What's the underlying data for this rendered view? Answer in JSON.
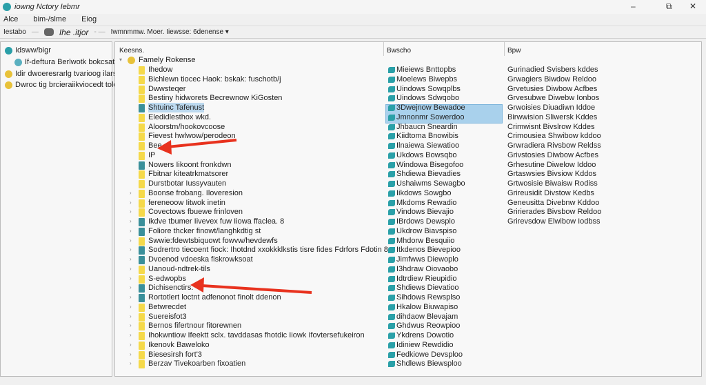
{
  "window": {
    "title": "iowng Nctory Iebmr",
    "minimize": "–",
    "maximize": "⧉",
    "close": "✕"
  },
  "menu": [
    "Alce",
    "bim-/slme",
    "Eiog"
  ],
  "toolbar": {
    "left": "Iestabo",
    "path": "Ihe .itjor",
    "crumb": "Iwmnmmw. Moer. Iiewsse: 6denense ▾"
  },
  "sidebar": [
    {
      "label": "Idsww/bigr",
      "icon": "globe-icon"
    },
    {
      "label": "If-deftura Berlwotk bokcsats",
      "icon": "network-icon"
    },
    {
      "label": "Idir dwoeresrarlg tvarioog ilarse",
      "icon": "gear-icon"
    },
    {
      "label": "Dwroc tig brcieraiikviocedt tolesir",
      "icon": "key-icon"
    }
  ],
  "columns": {
    "name": "Keesns.",
    "data": "Bwscho",
    "type": "Bpw"
  },
  "root": "Famely Rokense",
  "rows": [
    {
      "n": "Ihedow",
      "d": "Mieiews Bnttopbs",
      "t": "Gurinadied Svisbers kddes"
    },
    {
      "n": "Bichlewn tiocec Haok: bskak: fuschotb/j",
      "d": "Moelews Biwepbs",
      "t": "Grwagiers Biwdow Reldoo"
    },
    {
      "n": "Dwwsteqer",
      "d": "Uindows Sowqplbs",
      "t": "Grvetusies Diwbow Acfbes"
    },
    {
      "n": "Bestiny hidworets Becrewnow KiGosten",
      "d": "Uindows Sdwqobo",
      "t": "Grvesubwe Diwebw Ionbos"
    },
    {
      "n": "Shtuinc Tafenust",
      "d": "3Dwejnow Bewadoe",
      "t": "Grwoisies Diuadiwn Iddoe",
      "sel": true
    },
    {
      "n": "Eledidlesthox wkd.",
      "d": "Jmnonmr Sowerdoo",
      "t": "Birwwision Sliwersk Kddes",
      "sel2": true
    },
    {
      "n": "Aloorstm/hookovcoose",
      "d": "Jhbaucn Sneardin",
      "t": "Crimwisnt Bivslrow Kddes"
    },
    {
      "n": "Fievest hwlwow/perodeon",
      "d": "Kiidtoma Bnowibis",
      "t": "Crimousiea Shwibow kddoo"
    },
    {
      "n": "Bee",
      "d": "Ilnaiewa Siewatioo",
      "t": "Grwradiera Rivsbow Reldss"
    },
    {
      "n": "IP",
      "d": "Ukdows Bowsqbo",
      "t": "Grivstosies Diwbow Acfbes"
    },
    {
      "n": "Nowers Iikoont fronkdwn",
      "d": "Windowa Bisegofoo",
      "t": "Grhesutine Diwelow Iddoo"
    },
    {
      "n": "Fbitnar kiteatrkmatsorer",
      "d": "Shdiewa Bievadies",
      "t": "Grtaswsies Bivsiow Kddos"
    },
    {
      "n": "Durstbotar Iussyvauten",
      "d": "Ushaiwms Sewagbo",
      "t": "Grtwosisie Biwaisw Rodiss"
    },
    {
      "n": "Boonse frobang. Iloveresion",
      "d": "Iikdows Sowgbo",
      "t": "Grireusidit Divstow Kedbs"
    },
    {
      "n": "fereneoow Iitwok inetin",
      "d": "Mkdoms Rewadio",
      "t": "Geneusitta Divebnw Kddoo"
    },
    {
      "n": "Covectows fbuewe frinloven",
      "d": "Vindows Bievajio",
      "t": "Gririerades Bivsbow Reldoo"
    },
    {
      "n": "Ikdve tbumer Iivevex fuw Iiowa ffaclea. 8",
      "d": "IBrdows Dewsplo",
      "t": "Grirevsdow Elwibow Iodbss"
    },
    {
      "n": "Foliore thcker finowt/langhkdtig st",
      "d": "Ukdrow Biavspiso",
      "t": ""
    },
    {
      "n": "Swwie:fdewtsbiquowt fowvw/hevdewfs",
      "d": "Mhdorw Besquiio",
      "t": ""
    },
    {
      "n": "Sodrertro tiecoent fiock: Ihotdnd xxokkklkstis tisre fides Fdrfors Fdotin 8",
      "d": "Itkdenos Bievepioo",
      "t": ""
    },
    {
      "n": "Dvoenod vdoeska fiskrowksoat",
      "d": "Jimfwws Diewoplo",
      "t": ""
    },
    {
      "n": "Uanoud-ndtrek-tils",
      "d": "I3hdraw Oiovaobo",
      "t": ""
    },
    {
      "n": "S-edwopbs",
      "d": "Idtrdiew Rieupidio",
      "t": ""
    },
    {
      "n": "Dichisenctirs.",
      "d": "Shdiews Dievatioo",
      "t": ""
    },
    {
      "n": "Rortotlert loctnt adfenonot finolt ddenon",
      "d": "Sihdows Rewsplso",
      "t": ""
    },
    {
      "n": "Betwrecdet",
      "d": "Hkalow Biuwapiso",
      "t": ""
    },
    {
      "n": "Suereisfot3",
      "d": "dihdaow Blevajam",
      "t": ""
    },
    {
      "n": "Bernos fifertnour fitorewnen",
      "d": "Ghdwus Reowpioo",
      "t": ""
    },
    {
      "n": "Ihokwntiow Ifeektt sclx. tavddasas fhotdic Iiowk Ifovtersefukeiron",
      "d": "Ykdrens Dowotio",
      "t": ""
    },
    {
      "n": "Ikenovk Baweloko",
      "d": "Idiniew Rewdidio",
      "t": ""
    },
    {
      "n": "Biesesirsh fort'3",
      "d": "Fedkiowe Devsploo",
      "t": ""
    },
    {
      "n": "Berzav Tivekoarben fixoatien",
      "d": "Shdlews Biewsploo",
      "t": ""
    }
  ]
}
